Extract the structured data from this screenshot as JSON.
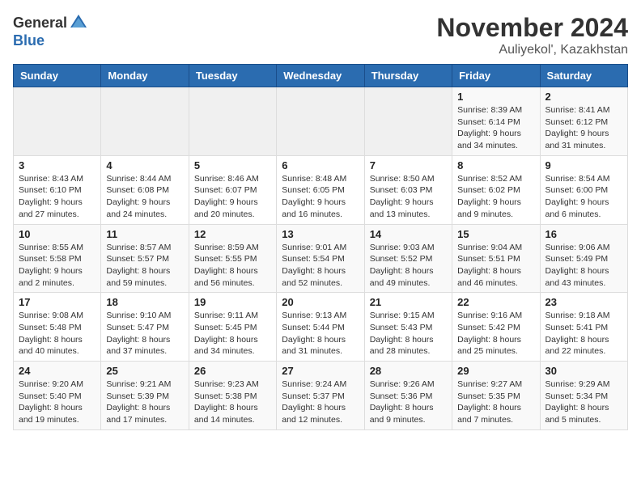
{
  "header": {
    "logo_general": "General",
    "logo_blue": "Blue",
    "month_year": "November 2024",
    "location": "Auliyekol', Kazakhstan"
  },
  "weekdays": [
    "Sunday",
    "Monday",
    "Tuesday",
    "Wednesday",
    "Thursday",
    "Friday",
    "Saturday"
  ],
  "weeks": [
    [
      {
        "day": "",
        "info": ""
      },
      {
        "day": "",
        "info": ""
      },
      {
        "day": "",
        "info": ""
      },
      {
        "day": "",
        "info": ""
      },
      {
        "day": "",
        "info": ""
      },
      {
        "day": "1",
        "info": "Sunrise: 8:39 AM\nSunset: 6:14 PM\nDaylight: 9 hours\nand 34 minutes."
      },
      {
        "day": "2",
        "info": "Sunrise: 8:41 AM\nSunset: 6:12 PM\nDaylight: 9 hours\nand 31 minutes."
      }
    ],
    [
      {
        "day": "3",
        "info": "Sunrise: 8:43 AM\nSunset: 6:10 PM\nDaylight: 9 hours\nand 27 minutes."
      },
      {
        "day": "4",
        "info": "Sunrise: 8:44 AM\nSunset: 6:08 PM\nDaylight: 9 hours\nand 24 minutes."
      },
      {
        "day": "5",
        "info": "Sunrise: 8:46 AM\nSunset: 6:07 PM\nDaylight: 9 hours\nand 20 minutes."
      },
      {
        "day": "6",
        "info": "Sunrise: 8:48 AM\nSunset: 6:05 PM\nDaylight: 9 hours\nand 16 minutes."
      },
      {
        "day": "7",
        "info": "Sunrise: 8:50 AM\nSunset: 6:03 PM\nDaylight: 9 hours\nand 13 minutes."
      },
      {
        "day": "8",
        "info": "Sunrise: 8:52 AM\nSunset: 6:02 PM\nDaylight: 9 hours\nand 9 minutes."
      },
      {
        "day": "9",
        "info": "Sunrise: 8:54 AM\nSunset: 6:00 PM\nDaylight: 9 hours\nand 6 minutes."
      }
    ],
    [
      {
        "day": "10",
        "info": "Sunrise: 8:55 AM\nSunset: 5:58 PM\nDaylight: 9 hours\nand 2 minutes."
      },
      {
        "day": "11",
        "info": "Sunrise: 8:57 AM\nSunset: 5:57 PM\nDaylight: 8 hours\nand 59 minutes."
      },
      {
        "day": "12",
        "info": "Sunrise: 8:59 AM\nSunset: 5:55 PM\nDaylight: 8 hours\nand 56 minutes."
      },
      {
        "day": "13",
        "info": "Sunrise: 9:01 AM\nSunset: 5:54 PM\nDaylight: 8 hours\nand 52 minutes."
      },
      {
        "day": "14",
        "info": "Sunrise: 9:03 AM\nSunset: 5:52 PM\nDaylight: 8 hours\nand 49 minutes."
      },
      {
        "day": "15",
        "info": "Sunrise: 9:04 AM\nSunset: 5:51 PM\nDaylight: 8 hours\nand 46 minutes."
      },
      {
        "day": "16",
        "info": "Sunrise: 9:06 AM\nSunset: 5:49 PM\nDaylight: 8 hours\nand 43 minutes."
      }
    ],
    [
      {
        "day": "17",
        "info": "Sunrise: 9:08 AM\nSunset: 5:48 PM\nDaylight: 8 hours\nand 40 minutes."
      },
      {
        "day": "18",
        "info": "Sunrise: 9:10 AM\nSunset: 5:47 PM\nDaylight: 8 hours\nand 37 minutes."
      },
      {
        "day": "19",
        "info": "Sunrise: 9:11 AM\nSunset: 5:45 PM\nDaylight: 8 hours\nand 34 minutes."
      },
      {
        "day": "20",
        "info": "Sunrise: 9:13 AM\nSunset: 5:44 PM\nDaylight: 8 hours\nand 31 minutes."
      },
      {
        "day": "21",
        "info": "Sunrise: 9:15 AM\nSunset: 5:43 PM\nDaylight: 8 hours\nand 28 minutes."
      },
      {
        "day": "22",
        "info": "Sunrise: 9:16 AM\nSunset: 5:42 PM\nDaylight: 8 hours\nand 25 minutes."
      },
      {
        "day": "23",
        "info": "Sunrise: 9:18 AM\nSunset: 5:41 PM\nDaylight: 8 hours\nand 22 minutes."
      }
    ],
    [
      {
        "day": "24",
        "info": "Sunrise: 9:20 AM\nSunset: 5:40 PM\nDaylight: 8 hours\nand 19 minutes."
      },
      {
        "day": "25",
        "info": "Sunrise: 9:21 AM\nSunset: 5:39 PM\nDaylight: 8 hours\nand 17 minutes."
      },
      {
        "day": "26",
        "info": "Sunrise: 9:23 AM\nSunset: 5:38 PM\nDaylight: 8 hours\nand 14 minutes."
      },
      {
        "day": "27",
        "info": "Sunrise: 9:24 AM\nSunset: 5:37 PM\nDaylight: 8 hours\nand 12 minutes."
      },
      {
        "day": "28",
        "info": "Sunrise: 9:26 AM\nSunset: 5:36 PM\nDaylight: 8 hours\nand 9 minutes."
      },
      {
        "day": "29",
        "info": "Sunrise: 9:27 AM\nSunset: 5:35 PM\nDaylight: 8 hours\nand 7 minutes."
      },
      {
        "day": "30",
        "info": "Sunrise: 9:29 AM\nSunset: 5:34 PM\nDaylight: 8 hours\nand 5 minutes."
      }
    ]
  ]
}
